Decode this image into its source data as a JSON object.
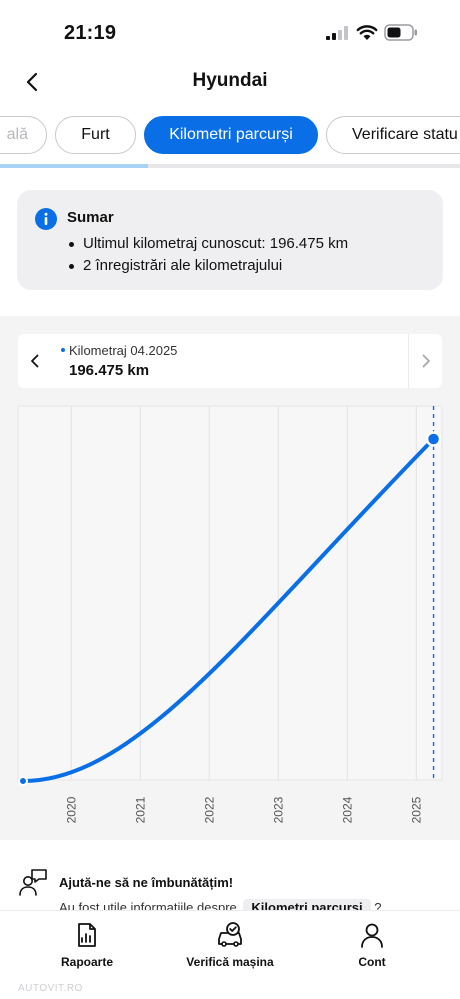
{
  "status_bar": {
    "time": "21:19"
  },
  "header": {
    "title": "Hyundai"
  },
  "tabs": [
    {
      "label": "ală"
    },
    {
      "label": "Furt"
    },
    {
      "label": "Kilometri parcurși"
    },
    {
      "label": "Verificare statu"
    }
  ],
  "active_tab": "Kilometri parcurși",
  "summary": {
    "title": "Sumar",
    "items": [
      "Ultimul kilometraj cunoscut: 196.475 km",
      "2 înregistrări ale kilometrajului"
    ]
  },
  "selected_point": {
    "label": "Kilometraj 04.2025",
    "value": "196.475 km"
  },
  "chart_data": {
    "type": "line",
    "title": "",
    "xlabel": "",
    "ylabel": "",
    "x_tick_labels": [
      "2020",
      "2021",
      "2022",
      "2023",
      "2024",
      "2025"
    ],
    "xlim": [
      2019.3,
      2025.3
    ],
    "series": [
      {
        "points": [
          {
            "x": "2019",
            "y": 0
          },
          {
            "x": "04.2025",
            "y": 196475
          }
        ]
      }
    ],
    "line_color": "#0a6fe6",
    "grid": "vertical",
    "selected_marker": "04.2025"
  },
  "feedback": {
    "title": "Ajută-ne să ne îmbunătățim!",
    "text": "Au fost utile informațiile despre",
    "chip": "Kilometri parcurși",
    "suffix": "?"
  },
  "bottom_nav": [
    {
      "label": "Rapoarte",
      "icon": "report-icon"
    },
    {
      "label": "Verifică mașina",
      "icon": "car-check-icon"
    },
    {
      "label": "Cont",
      "icon": "account-icon"
    }
  ],
  "watermark": "AUTOVIT.RO",
  "colors": {
    "accent": "#0a6fe6",
    "summary_bg": "#efeff1",
    "chart_bg": "#f4f4f5"
  }
}
